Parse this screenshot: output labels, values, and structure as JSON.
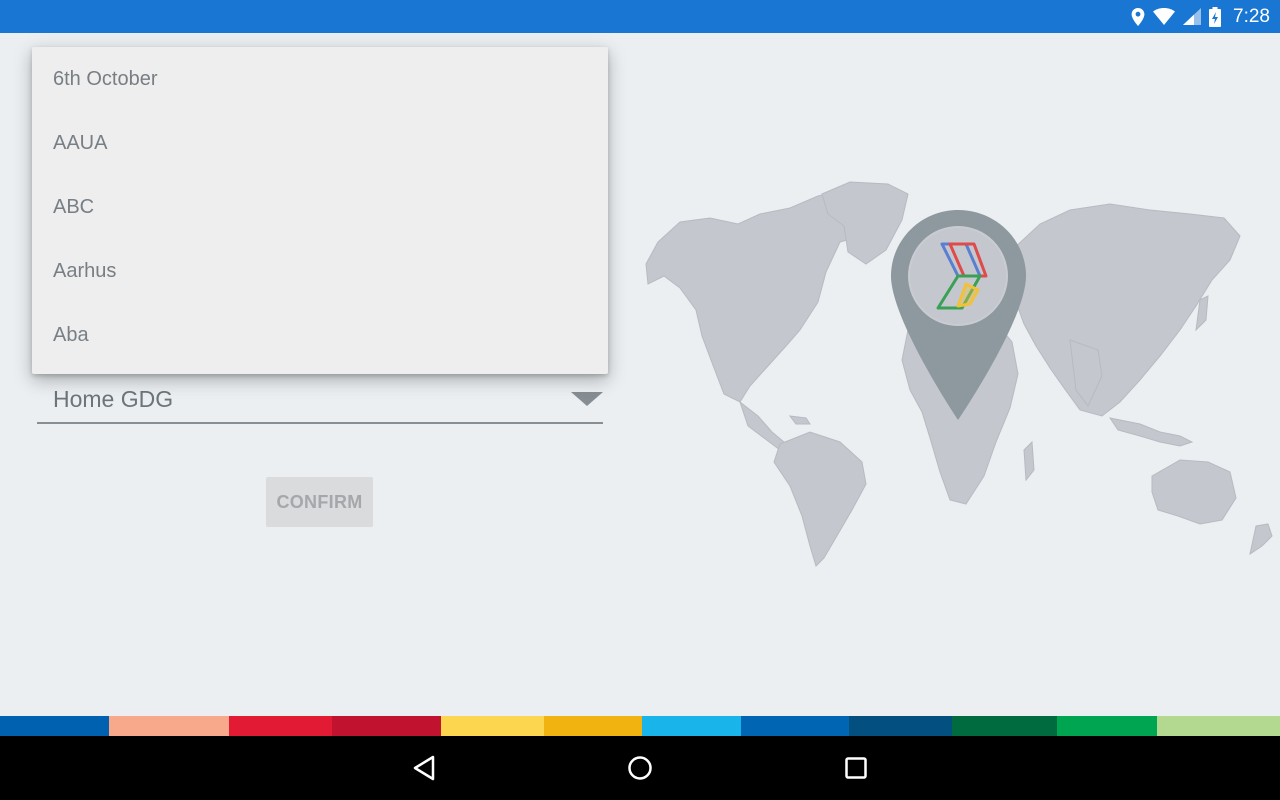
{
  "status_bar": {
    "time": "7:28",
    "icons": [
      "location-icon",
      "wifi-icon",
      "signal-icon",
      "battery-charging-icon"
    ],
    "color": "#1976d2"
  },
  "dropdown": {
    "options": [
      "6th October",
      "AAUA",
      "ABC",
      "Aarhus",
      "Aba"
    ]
  },
  "spinner": {
    "selected": "Home GDG"
  },
  "confirm_button": {
    "label": "CONFIRM",
    "enabled": false
  },
  "illustration": {
    "icon": "world-map-with-location-pin",
    "pin_logo": "gdg-chevron-logo"
  },
  "color_strip": [
    "#0061b0",
    "#f8a98c",
    "#e31a33",
    "#c1132f",
    "#fdd650",
    "#f0b30f",
    "#19b5ea",
    "#0066b3",
    "#034f80",
    "#006b3f",
    "#00a551",
    "#b3d890"
  ],
  "nav_bar": {
    "buttons": [
      "back-icon",
      "home-icon",
      "recents-icon"
    ]
  }
}
